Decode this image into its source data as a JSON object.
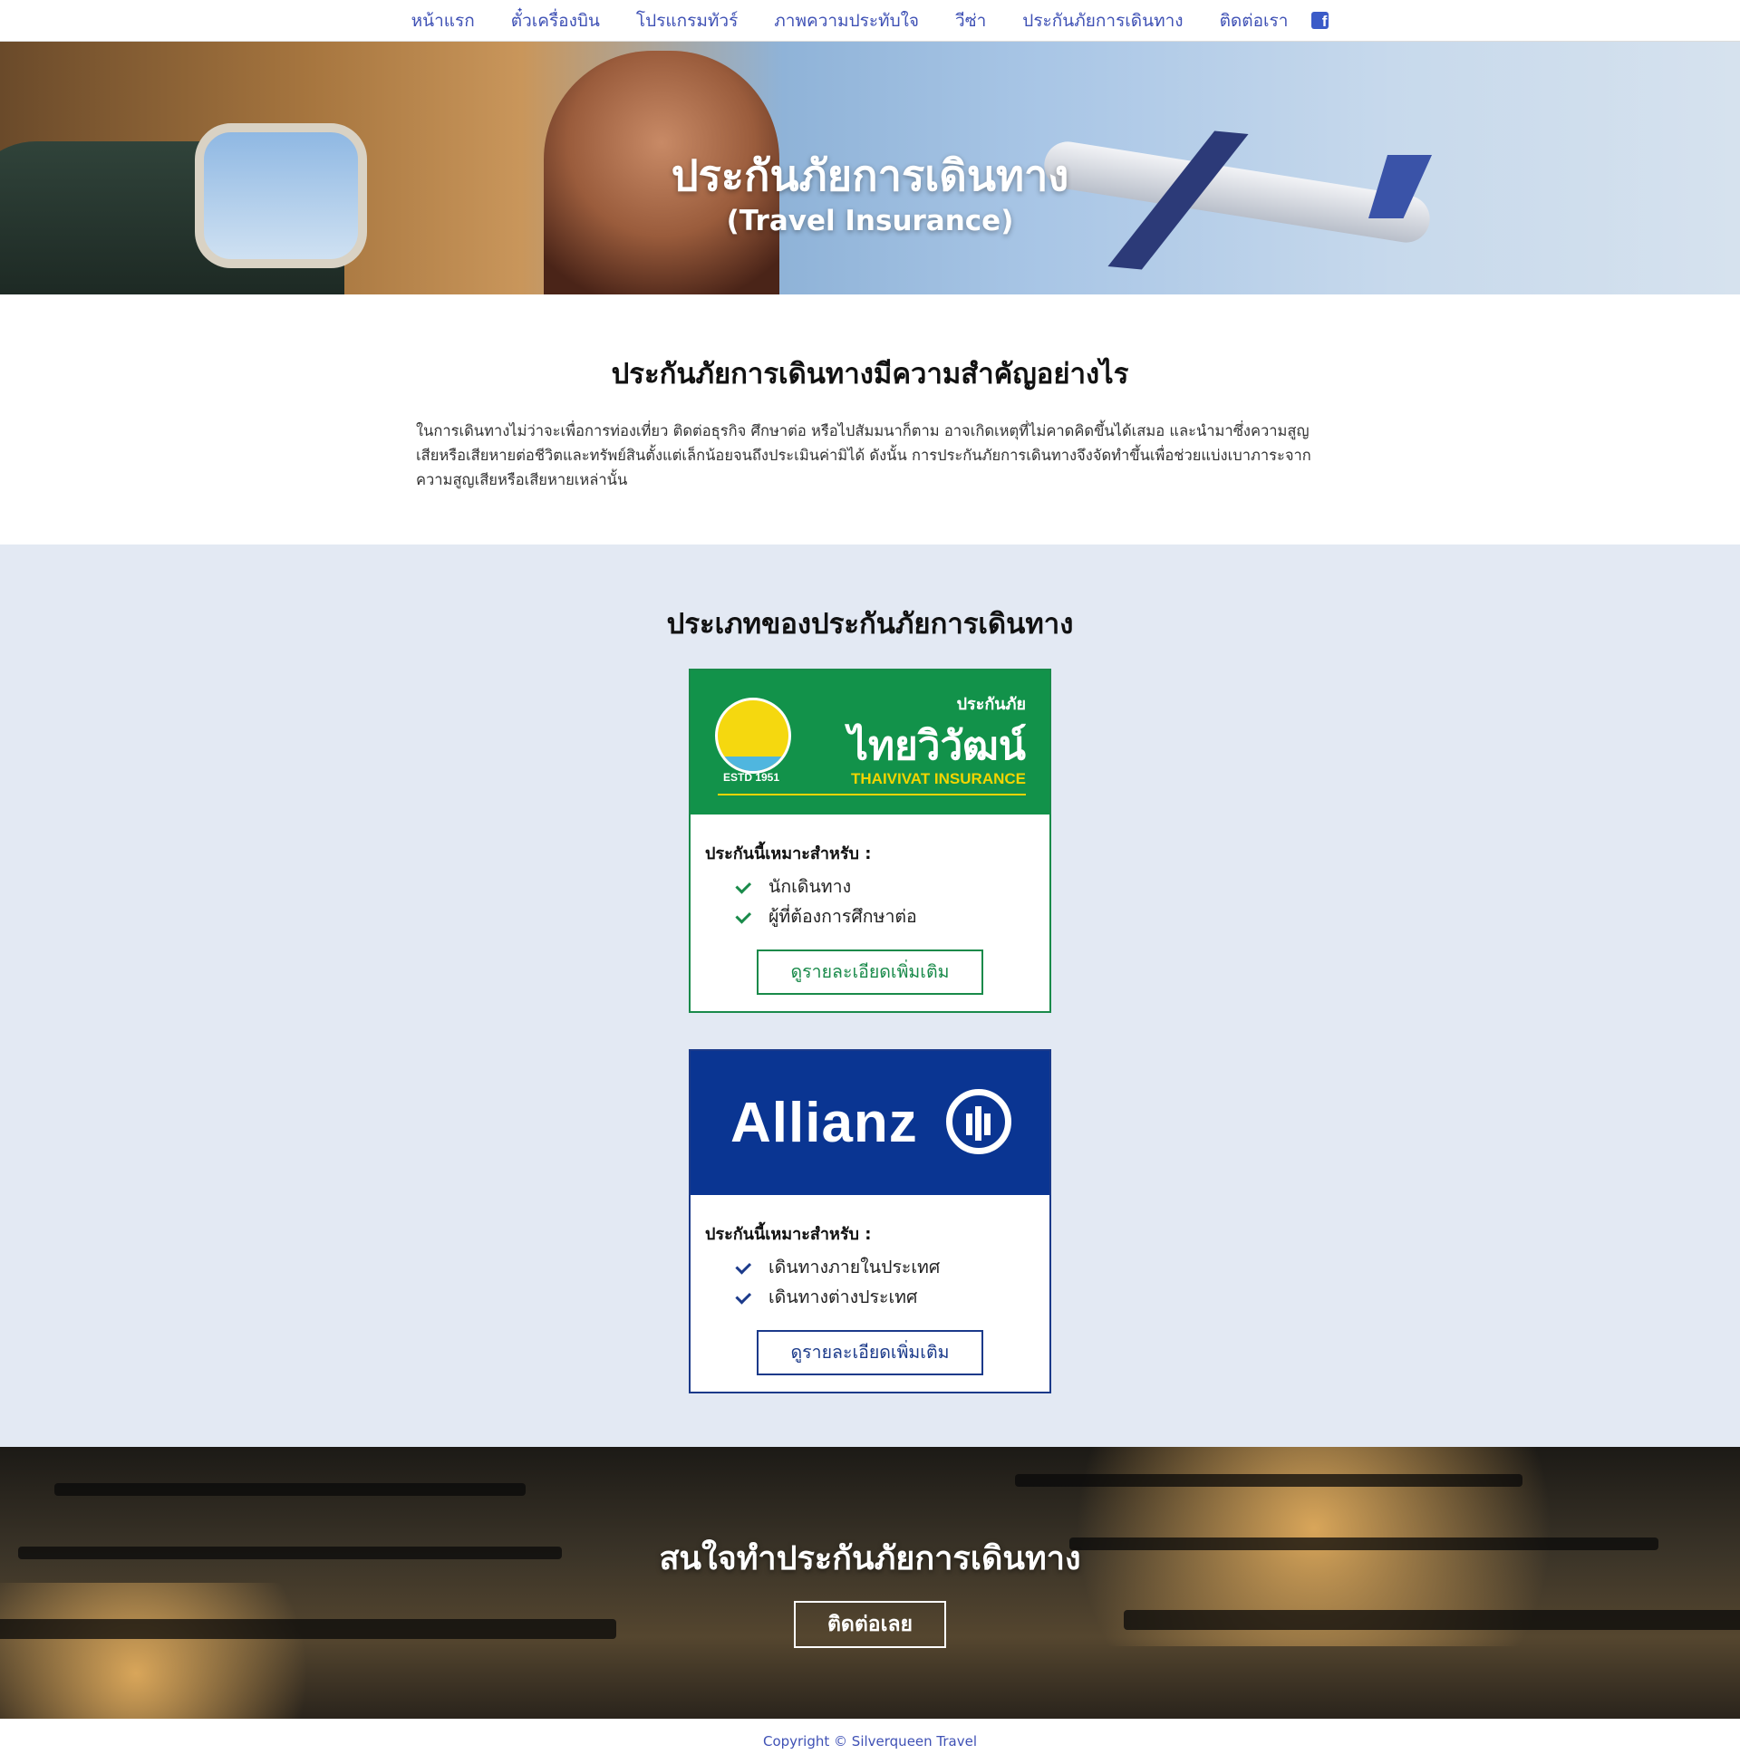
{
  "nav": {
    "items": [
      "หน้าแรก",
      "ตั๋วเครื่องบิน",
      "โปรแกรมทัวร์",
      "ภาพความประทับใจ",
      "วีซ่า",
      "ประกันภัยการเดินทาง",
      "ติดต่อเรา"
    ],
    "facebook_icon": "facebook-icon",
    "facebook_glyph": "f"
  },
  "hero": {
    "title": "ประกันภัยการเดินทาง",
    "subtitle": "(Travel Insurance)"
  },
  "why": {
    "title": "ประกันภัยการเดินทางมีความสำคัญอย่างไร",
    "text": "ในการเดินทางไม่ว่าจะเพื่อการท่องเที่ยว ติดต่อธุรกิจ ศึกษาต่อ หรือไปสัมมนาก็ตาม อาจเกิดเหตุที่ไม่คาดคิดขึ้นได้เสมอ และนำมาซึ่งความสูญเสียหรือเสียหายต่อชีวิตและทรัพย์สินตั้งแต่เล็กน้อยจนถึงประเมินค่ามิได้ ดังนั้น การประกันภัยการเดินทางจึงจัดทำขึ้นเพื่อช่วยแบ่งเบาภาระจากความสูญเสียหรือเสียหายเหล่านั้น"
  },
  "types": {
    "title": "ประเภทของประกันภัยการเดินทาง",
    "cards": [
      {
        "logo": {
          "small": "ประกันภัย",
          "big": "ไทยวิวัฒน์",
          "english": "THAIVIVAT INSURANCE",
          "estd": "ESTD 1951"
        },
        "suitable_label": "ประกันนี้เหมาะสำหรับ :",
        "items": [
          "นักเดินทาง",
          "ผู้ที่ต้องการศึกษาต่อ"
        ],
        "button": "ดูรายละเอียดเพิ่มเติม",
        "color": "#198a4a"
      },
      {
        "logo": {
          "word": "Allianz"
        },
        "suitable_label": "ประกันนี้เหมาะสำหรับ :",
        "items": [
          "เดินทางภายในประเทศ",
          "เดินทางต่างประเทศ"
        ],
        "button": "ดูรายละเอียดเพิ่มเติม",
        "color": "#1b3a8a"
      }
    ]
  },
  "cta": {
    "title": "สนใจทำประกันภัยการเดินทาง",
    "button": "ติดต่อเลย"
  },
  "footer": {
    "text": "Copyright © Silverqueen Travel"
  }
}
